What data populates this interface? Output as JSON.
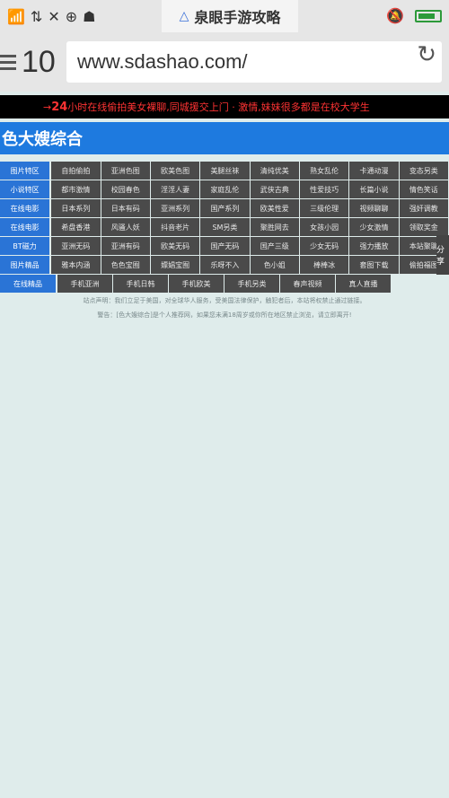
{
  "status_bar": {
    "icons": [
      "signal-icon",
      "data-icon",
      "signal-x-icon",
      "search-plus-icon",
      "android-icon"
    ],
    "banner": "泉眼手游攻略",
    "right_icons": [
      "mute-icon",
      "battery-icon"
    ]
  },
  "browser": {
    "tab_count": "10",
    "url": "www.sdashao.com/"
  },
  "marquee": {
    "prefix": "→ ",
    "highlight": "24",
    "text": "小时在线偷拍美女裸聊,同城援交上门 · 激情,妹妹很多都是在校大学生"
  },
  "site_title": "色大嫂综合",
  "grid": [
    {
      "cat": "图片特区",
      "cells": [
        "自拍偷拍",
        "亚洲色图",
        "欧美色图",
        "美腿丝袜",
        "清纯优美",
        "熟女乱伦",
        "卡通动漫",
        "变态另类"
      ]
    },
    {
      "cat": "小说特区",
      "cells": [
        "都市激情",
        "校园春色",
        "淫淫人妻",
        "家庭乱伦",
        "武侠古典",
        "性爱技巧",
        "长篇小说",
        "情色笑话"
      ]
    },
    {
      "cat": "在线电影",
      "cells": [
        "日本系列",
        "日本有码",
        "亚洲系列",
        "国产系列",
        "欧美性爱",
        "三级伦理",
        "视频聊聊",
        "强奸调教"
      ]
    },
    {
      "cat": "在线电影",
      "cells": [
        "希盘香港",
        "风骚人妖",
        "抖音老片",
        "SM另类",
        "聚胜网去",
        "女孩小园",
        "少女激情",
        "领取奖金"
      ]
    },
    {
      "cat": "BT磁力",
      "cells": [
        "亚洲无码",
        "亚洲有码",
        "欧美无码",
        "国产无码",
        "国产三级",
        "少女无码",
        "强力播放",
        "本站聚聊"
      ]
    },
    {
      "cat": "图片精品",
      "cells": [
        "雅本内涵",
        "色色宝囿",
        "嫖娼宝囿",
        "乐呀不入",
        "色小姐",
        "棒棒冰",
        "套图下载",
        "偷拍福图"
      ]
    },
    {
      "cat": "在线精品",
      "cells": [
        "手机亚洲",
        "手机日韩",
        "手机欧美",
        "手机另类",
        "春声视频",
        "真人直播"
      ]
    }
  ],
  "footer": {
    "line1": "站点声明：我们立足于美国，对全球华人服务，受美国法律保护，触犯者后，本站将权禁止通过链接。",
    "line2_prefix": "警告：",
    "line2_brand": "[色大嫂综合]",
    "line2_rest": "是个人推荐网，如果您未满18周岁或你所在地区禁止浏览，请立即离开!"
  },
  "share_label": "分享"
}
